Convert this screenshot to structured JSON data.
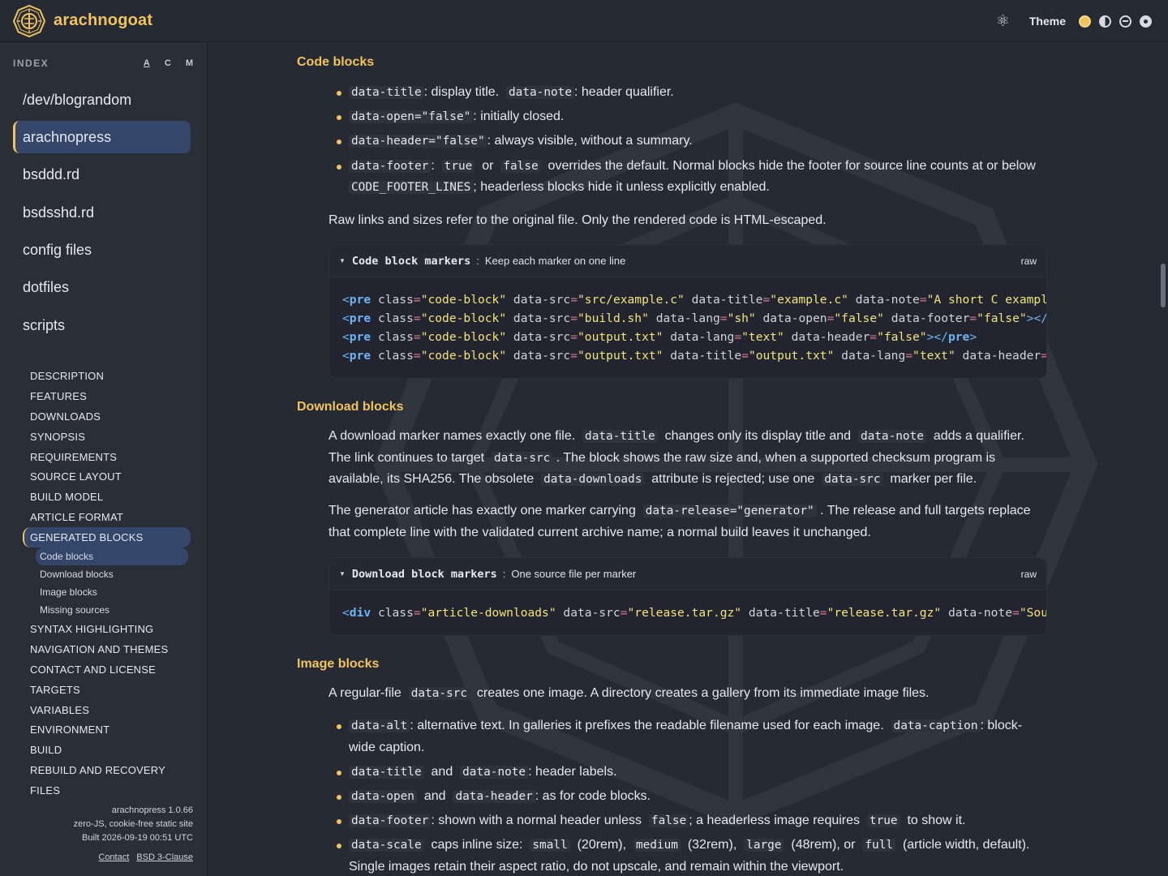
{
  "header": {
    "brand": "arachnogoat",
    "theme_label": "Theme",
    "icons": [
      "atom-icon",
      "theme-gold-icon",
      "theme-contrast-icon",
      "theme-mask-icon",
      "theme-dark-icon"
    ]
  },
  "sidebar": {
    "index_label": "INDEX",
    "sort_options": [
      "A",
      "C",
      "M"
    ],
    "articles": [
      "/dev/blograndom",
      "arachnopress",
      "bsddd.rd",
      "bsdsshd.rd",
      "config files",
      "dotfiles",
      "scripts"
    ],
    "active_article": "arachnopress",
    "toc_before": [
      "DESCRIPTION",
      "FEATURES",
      "DOWNLOADS",
      "SYNOPSIS",
      "REQUIREMENTS",
      "SOURCE LAYOUT",
      "BUILD MODEL",
      "ARTICLE FORMAT"
    ],
    "toc_active": "GENERATED BLOCKS",
    "toc_sub": [
      "Code blocks",
      "Download blocks",
      "Image blocks",
      "Missing sources"
    ],
    "toc_after": [
      "SYNTAX HIGHLIGHTING",
      "NAVIGATION AND THEMES",
      "CONTACT AND LICENSE",
      "TARGETS",
      "VARIABLES",
      "ENVIRONMENT",
      "BUILD",
      "REBUILD AND RECOVERY",
      "FILES"
    ],
    "footer": {
      "version": "arachnopress 1.0.66",
      "tagline": "zero-JS, cookie-free static site",
      "built": "Built 2026-09-19 00:51 UTC",
      "contact": "Contact",
      "license": "BSD 3-Clause"
    }
  },
  "main": {
    "code_blocks": {
      "heading": "Code blocks",
      "b1_code1": "data-title",
      "b1_t1": ": display title.",
      "b1_code2": "data-note",
      "b1_t2": ": header qualifier.",
      "b2_code": "data-open=\"false\"",
      "b2_t": ": initially closed.",
      "b3_code": "data-header=\"false\"",
      "b3_t": ": always visible, without a summary.",
      "b4_code1": "data-footer",
      "b4_t1": ":",
      "b4_code2": "true",
      "b4_t2": "or",
      "b4_code3": "false",
      "b4_t3": "overrides the default. Normal blocks hide the footer for source line counts at or below",
      "b4_code4": "CODE_FOOTER_LINES",
      "b4_t4": "; headerless blocks hide it unless explicitly enabled.",
      "para": "Raw links and sizes refer to the original file. Only the rendered code is HTML-escaped.",
      "box_title": "Code block markers",
      "box_note": "Keep each marker on one line",
      "box_raw": "raw"
    },
    "download_blocks": {
      "heading": "Download blocks",
      "p1_t1": "A download marker names exactly one file.",
      "p1_c1": "data-title",
      "p1_t2": "changes only its display title and",
      "p1_c2": "data-note",
      "p1_t3": "adds a qualifier.",
      "p1_t4": "The link continues to target",
      "p1_c3": "data-src",
      "p1_t5": ". The block shows the raw size and, when a supported checksum program is",
      "p1_t6": "available, its SHA256. The obsolete",
      "p1_c4": "data-downloads",
      "p1_t7": "attribute is rejected; use one",
      "p1_c5": "data-src",
      "p1_t8": "marker per file.",
      "p2_t1": "The generator article has exactly one marker carrying",
      "p2_c1": "data-release=\"generator\"",
      "p2_t2": ". The release and full targets replace",
      "p2_t3": "that complete line with the validated current archive name; a normal build leaves it unchanged.",
      "box_title": "Download block markers",
      "box_note": "One source file per marker",
      "box_raw": "raw"
    },
    "image_blocks": {
      "heading": "Image blocks",
      "p1_t1": "A regular-file",
      "p1_c1": "data-src",
      "p1_t2": "creates one image. A directory creates a gallery from its immediate image files.",
      "b1_c1": "data-alt",
      "b1_t1": ": alternative text. In galleries it prefixes the readable filename used for each image.",
      "b1_c2": "data-caption",
      "b1_t2": ": block-",
      "b1_t3": "wide caption.",
      "b2_c1": "data-title",
      "b2_t1": "and",
      "b2_c2": "data-note",
      "b2_t2": ": header labels.",
      "b3_c1": "data-open",
      "b3_t1": "and",
      "b3_c2": "data-header",
      "b3_t2": ": as for code blocks.",
      "b4_c1": "data-footer",
      "b4_t1": ": shown with a normal header unless",
      "b4_c2": "false",
      "b4_t2": "; a headerless image requires",
      "b4_c3": "true",
      "b4_t3": "to show it.",
      "b5_c1": "data-scale",
      "b5_t1": "caps inline size:",
      "b5_c2": "small",
      "b5_t2": "(20rem),",
      "b5_c3": "medium",
      "b5_t3": "(32rem),",
      "b5_c4": "large",
      "b5_t4": "(48rem), or",
      "b5_c5": "full",
      "b5_t5": "(article width, default).",
      "b5_t6": "Single images retain their aspect ratio, do not upscale, and remain within the viewport."
    }
  },
  "colors": {
    "accent": "#f0c35e",
    "background": "#262a33",
    "sidebar_active": "#34476b",
    "code_tag": "#6fb4f2",
    "code_string": "#f3e37a"
  }
}
